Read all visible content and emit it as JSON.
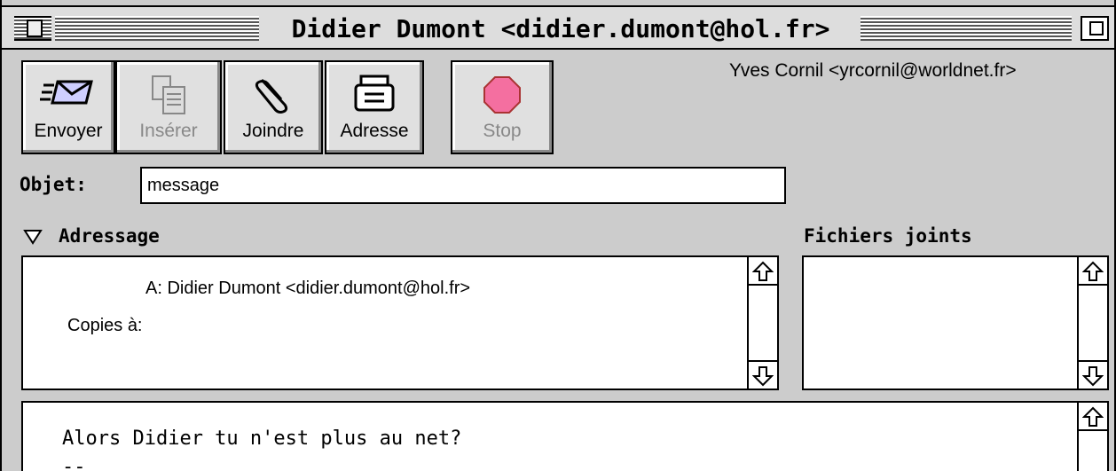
{
  "window": {
    "title": "Didier Dumont <didier.dumont@hol.fr>"
  },
  "toolbar": {
    "send_label": "Envoyer",
    "insert_label": "Insérer",
    "attach_label": "Joindre",
    "address_label": "Adresse",
    "stop_label": "Stop",
    "insert_disabled": true,
    "stop_disabled": true
  },
  "account": {
    "sender": "Yves Cornil <yrcornil@worldnet.fr>"
  },
  "subject": {
    "label": "Objet:",
    "value": "message"
  },
  "addressing": {
    "section_label": "Adressage",
    "to_label": "A:",
    "to_value": "Didier Dumont <didier.dumont@hol.fr>",
    "cc_label": "Copies à:",
    "cc_value": ""
  },
  "attachments": {
    "section_label": "Fichiers joints",
    "items": []
  },
  "message_body": {
    "line1": "Alors Didier tu n'est plus au net?",
    "line2": "--"
  },
  "colors": {
    "window_bg": "#cccccc",
    "stop_icon": "#ff6699"
  }
}
